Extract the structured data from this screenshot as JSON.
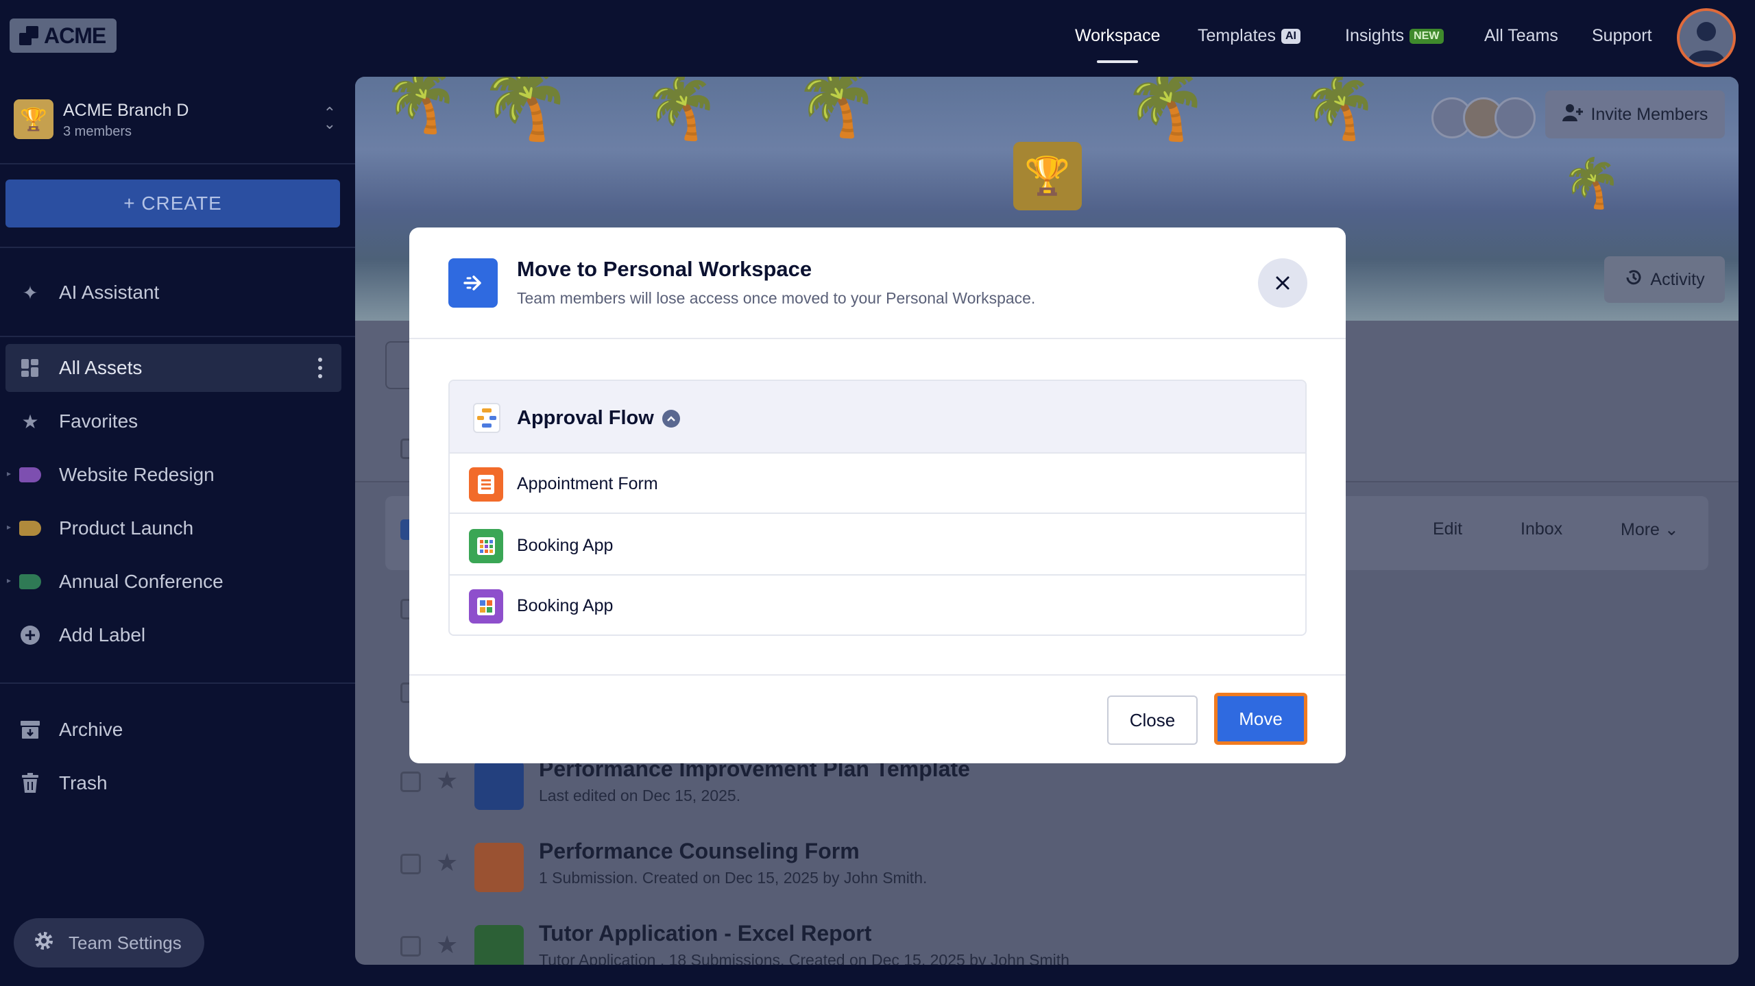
{
  "header": {
    "logo_text": "ACME",
    "nav": [
      {
        "label": "Workspace",
        "badge": ""
      },
      {
        "label": "Templates",
        "badge": "AI"
      },
      {
        "label": "Insights",
        "badge": "NEW"
      },
      {
        "label": "All Teams",
        "badge": ""
      },
      {
        "label": "Support",
        "badge": ""
      }
    ]
  },
  "sidebar": {
    "team_name": "ACME Branch D",
    "team_members": "3 members",
    "create_label": "+ CREATE",
    "ai_assistant": "AI Assistant",
    "all_assets": "All Assets",
    "favorites": "Favorites",
    "labels": [
      {
        "label": "Website Redesign",
        "color": "#7d4fb0"
      },
      {
        "label": "Product Launch",
        "color": "#b08a3c"
      },
      {
        "label": "Annual Conference",
        "color": "#2f7a55"
      }
    ],
    "add_label": "Add Label",
    "archive": "Archive",
    "trash": "Trash",
    "team_settings": "Team Settings"
  },
  "main": {
    "invite_label": "Invite Members",
    "activity_label": "Activity",
    "row_actions": {
      "edit": "Edit",
      "inbox": "Inbox",
      "more": "More"
    },
    "items": [
      {
        "title": "Performance Improvement Plan Template",
        "subtitle": "Last edited on Dec 15, 2025.",
        "icon": "report-icon",
        "color": "#2f5fd0"
      },
      {
        "title": "Performance Counseling Form",
        "subtitle": "1 Submission. Created on Dec 15, 2025 by John Smith.",
        "icon": "form-icon",
        "color": "#e46a2a"
      },
      {
        "title": "Tutor Application - Excel Report",
        "subtitle": "Tutor Application . 18 Submissions. Created on Dec 15, 2025 by John Smith",
        "icon": "xls-icon",
        "color": "#2b8a3e"
      }
    ]
  },
  "modal": {
    "title": "Move to Personal Workspace",
    "subtitle": "Team members will lose access once moved to your Personal Workspace.",
    "group_title": "Approval Flow",
    "assets": [
      {
        "label": "Appointment Form",
        "color": "#f26b2a",
        "icon": "form-icon"
      },
      {
        "label": "Booking App",
        "color": "#3aa655",
        "icon": "app-icon"
      },
      {
        "label": "Booking App",
        "color": "#8e4fcc",
        "icon": "app-icon"
      }
    ],
    "close_label": "Close",
    "move_label": "Move"
  }
}
